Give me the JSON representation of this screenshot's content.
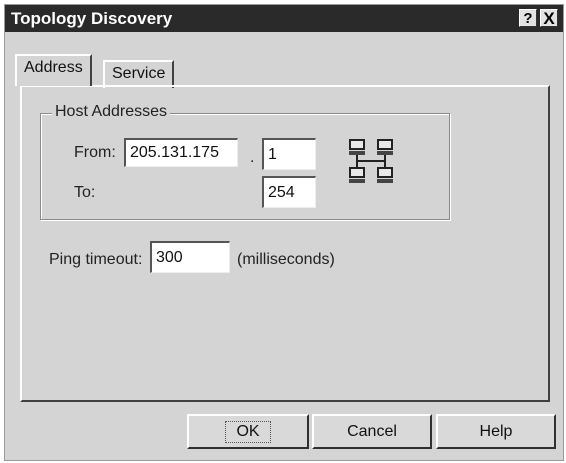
{
  "window": {
    "title": "Topology Discovery",
    "help_button": "?",
    "close_button": "X"
  },
  "tabs": [
    {
      "label": "Address",
      "selected": true
    },
    {
      "label": "Service",
      "selected": false
    }
  ],
  "host_addresses": {
    "group_label": "Host Addresses",
    "from_label": "From:",
    "from_prefix": "205.131.175",
    "separator": ".",
    "from_suffix": "1",
    "to_label": "To:",
    "to_suffix": "254",
    "icon": "network-computers-icon"
  },
  "ping": {
    "label": "Ping timeout:",
    "value": "300",
    "unit": "(milliseconds)"
  },
  "buttons": {
    "ok": "OK",
    "cancel": "Cancel",
    "help": "Help"
  }
}
